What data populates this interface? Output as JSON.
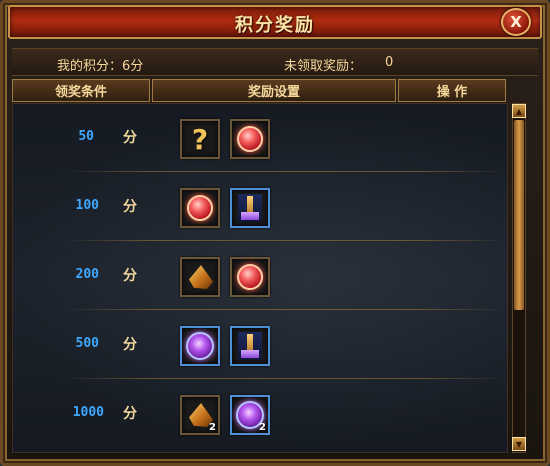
{
  "window": {
    "title": "积分奖励",
    "close_label": "X"
  },
  "summary": {
    "my_points_label": "我的积分：6分",
    "unclaimed_label": "未领取奖励：",
    "unclaimed_count": "0"
  },
  "table": {
    "headers": [
      "领奖条件",
      "奖励设置",
      "操 作"
    ],
    "unit": "分",
    "rows": [
      {
        "points": "50",
        "rewards": [
          {
            "icon": "mystery-box-icon",
            "count": ""
          },
          {
            "icon": "red-orb-icon",
            "count": ""
          }
        ]
      },
      {
        "points": "100",
        "rewards": [
          {
            "icon": "red-orb-icon",
            "count": ""
          },
          {
            "icon": "tower-item-icon",
            "count": ""
          }
        ]
      },
      {
        "points": "200",
        "rewards": [
          {
            "icon": "gold-gem-icon",
            "count": ""
          },
          {
            "icon": "red-orb-icon",
            "count": ""
          }
        ]
      },
      {
        "points": "500",
        "rewards": [
          {
            "icon": "purple-orb-icon",
            "count": ""
          },
          {
            "icon": "tower-item-icon",
            "count": ""
          }
        ]
      },
      {
        "points": "1000",
        "rewards": [
          {
            "icon": "gold-gem-icon",
            "count": "2"
          },
          {
            "icon": "purple-orb-icon",
            "count": "2"
          }
        ]
      }
    ]
  },
  "question_mark": "?"
}
